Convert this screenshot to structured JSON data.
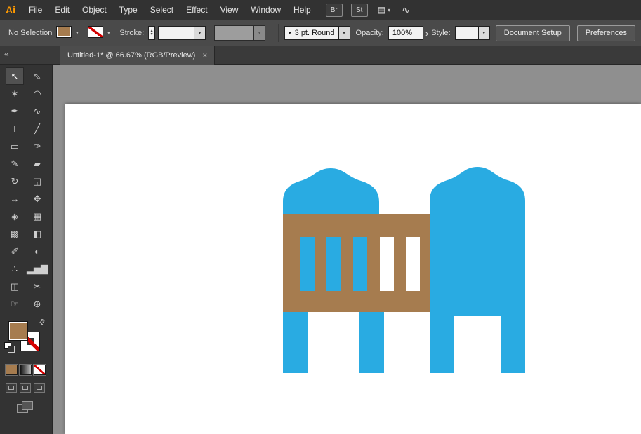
{
  "menubar": {
    "logo": "Ai",
    "items": [
      "File",
      "Edit",
      "Object",
      "Type",
      "Select",
      "Effect",
      "View",
      "Window",
      "Help"
    ],
    "bridge_label": "Br",
    "stock_label": "St"
  },
  "controlbar": {
    "selection_status": "No Selection",
    "stroke_label": "Stroke:",
    "brush_style_dot": "•",
    "brush_style_value": "3 pt. Round",
    "opacity_label": "Opacity:",
    "opacity_value": "100%",
    "style_label": "Style:",
    "document_setup_label": "Document Setup",
    "preferences_label": "Preferences"
  },
  "tabbar": {
    "document_title": "Untitled-1* @ 66.67% (RGB/Preview)"
  },
  "icons": {
    "collapse": "«",
    "chevron": "▾",
    "stepper_up": "▲",
    "stepper_down": "▼",
    "menu_arrow": "›",
    "close": "×",
    "swap": "⇄",
    "workspace": "▤",
    "sync": "∿"
  },
  "tools": [
    {
      "name": "selection-tool",
      "glyph": "↖",
      "selected": true
    },
    {
      "name": "direct-selection-tool",
      "glyph": "⇖"
    },
    {
      "name": "magic-wand-tool",
      "glyph": "✶"
    },
    {
      "name": "lasso-tool",
      "glyph": "◠"
    },
    {
      "name": "pen-tool",
      "glyph": "✒"
    },
    {
      "name": "curvature-tool",
      "glyph": "∿"
    },
    {
      "name": "type-tool",
      "glyph": "T"
    },
    {
      "name": "line-segment-tool",
      "glyph": "╱"
    },
    {
      "name": "rectangle-tool",
      "glyph": "▭"
    },
    {
      "name": "paintbrush-tool",
      "glyph": "✑"
    },
    {
      "name": "pencil-tool",
      "glyph": "✎"
    },
    {
      "name": "eraser-tool",
      "glyph": "▰"
    },
    {
      "name": "rotate-tool",
      "glyph": "↻"
    },
    {
      "name": "scale-tool",
      "glyph": "◱"
    },
    {
      "name": "width-tool",
      "glyph": "↔"
    },
    {
      "name": "free-transform-tool",
      "glyph": "✥"
    },
    {
      "name": "shape-builder-tool",
      "glyph": "◈"
    },
    {
      "name": "perspective-grid-tool",
      "glyph": "▦"
    },
    {
      "name": "mesh-tool",
      "glyph": "▩"
    },
    {
      "name": "gradient-tool",
      "glyph": "◧"
    },
    {
      "name": "eyedropper-tool",
      "glyph": "✐"
    },
    {
      "name": "blend-tool",
      "glyph": "◐"
    },
    {
      "name": "symbol-sprayer-tool",
      "glyph": "∴"
    },
    {
      "name": "column-graph-tool",
      "glyph": "▂▅▇"
    },
    {
      "name": "artboard-tool",
      "glyph": "◫"
    },
    {
      "name": "slice-tool",
      "glyph": "✂"
    },
    {
      "name": "hand-tool",
      "glyph": "☞"
    },
    {
      "name": "zoom-tool",
      "glyph": "⊕"
    }
  ],
  "artwork": {
    "blue": "#29ABE2",
    "brown": "#A67C4F",
    "slat_white": "#FFFFFF"
  }
}
